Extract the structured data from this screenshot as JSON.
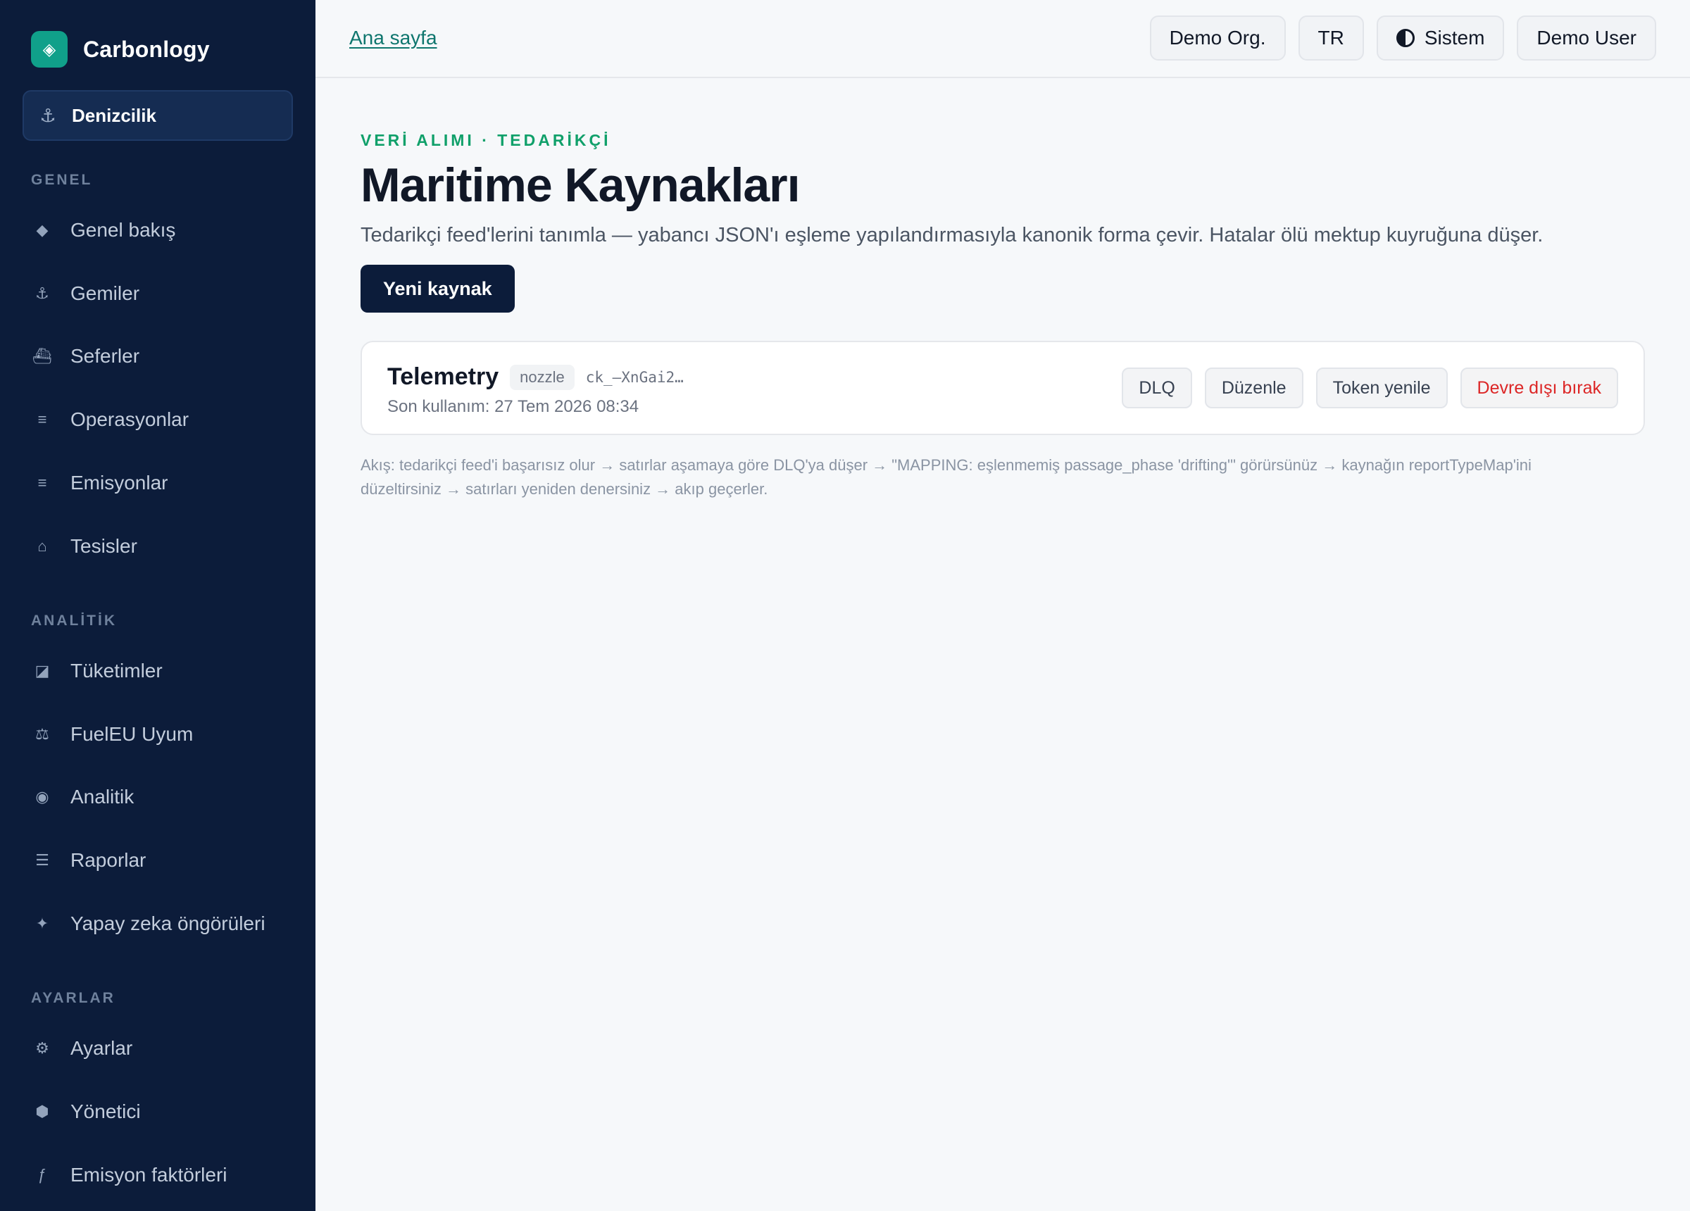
{
  "sidebar": {
    "brand": {
      "name": "Carbonlogy",
      "logo_icon": "◈"
    },
    "domain": {
      "label": "Denizcilik",
      "icon": "⚓"
    },
    "sections": [
      {
        "label": "GENEL"
      },
      {
        "label": "ANALİTİK"
      },
      {
        "label": "AYARLAR"
      }
    ],
    "items": [
      {
        "label": "Genel bakış",
        "icon": "◆"
      },
      {
        "label": "Gemiler",
        "icon": "⚓"
      },
      {
        "label": "Seferler",
        "icon": "⛴"
      },
      {
        "label": "Operasyonlar",
        "icon": "≡"
      },
      {
        "label": "Emisyonlar",
        "icon": "≡"
      },
      {
        "label": "Tesisler",
        "icon": "⌂"
      },
      {
        "label": "Tüketimler",
        "icon": "◪"
      },
      {
        "label": "FuelEU Uyum",
        "icon": "⚖"
      },
      {
        "label": "Analitik",
        "icon": "◉"
      },
      {
        "label": "Raporlar",
        "icon": "☰"
      },
      {
        "label": "Yapay zeka öngörüleri",
        "icon": "✦"
      },
      {
        "label": "Ayarlar",
        "icon": "⚙"
      },
      {
        "label": "Yönetici",
        "icon": "⬢"
      },
      {
        "label": "Emisyon faktörleri",
        "icon": "ƒ"
      }
    ]
  },
  "topbar": {
    "home_link": "Ana sayfa",
    "org": "Demo Org.",
    "lang": "TR",
    "theme": "Sistem",
    "user": "Demo User"
  },
  "main": {
    "eyebrow": "VERİ ALIMI · TEDARİKÇİ",
    "title": "Maritime Kaynakları",
    "description": "Tedarikçi feed'lerini tanımla — yabancı JSON'ı eşleme yapılandırmasıyla kanonik forma çevir. Hatalar ölü mektup kuyruğuna düşer.",
    "new_source_button": "Yeni kaynak",
    "source": {
      "name": "Telemetry",
      "tag": "nozzle",
      "token": "ck_–XnGai2…",
      "last_used": "Son kullanım: 27 Tem 2026 08:34",
      "actions": {
        "dlq": "DLQ",
        "edit": "Düzenle",
        "refresh_token": "Token yenile",
        "disable": "Devre dışı bırak"
      }
    },
    "flow_note": "Akış: tedarikçi feed'i başarısız olur → satırlar aşamaya göre DLQ'ya düşer → \"MAPPING: eşlenmemiş passage_phase 'drifting'\" görürsünüz → kaynağın reportTypeMap'ini düzeltirsiniz → satırları yeniden denersiniz → akıp geçerler."
  }
}
